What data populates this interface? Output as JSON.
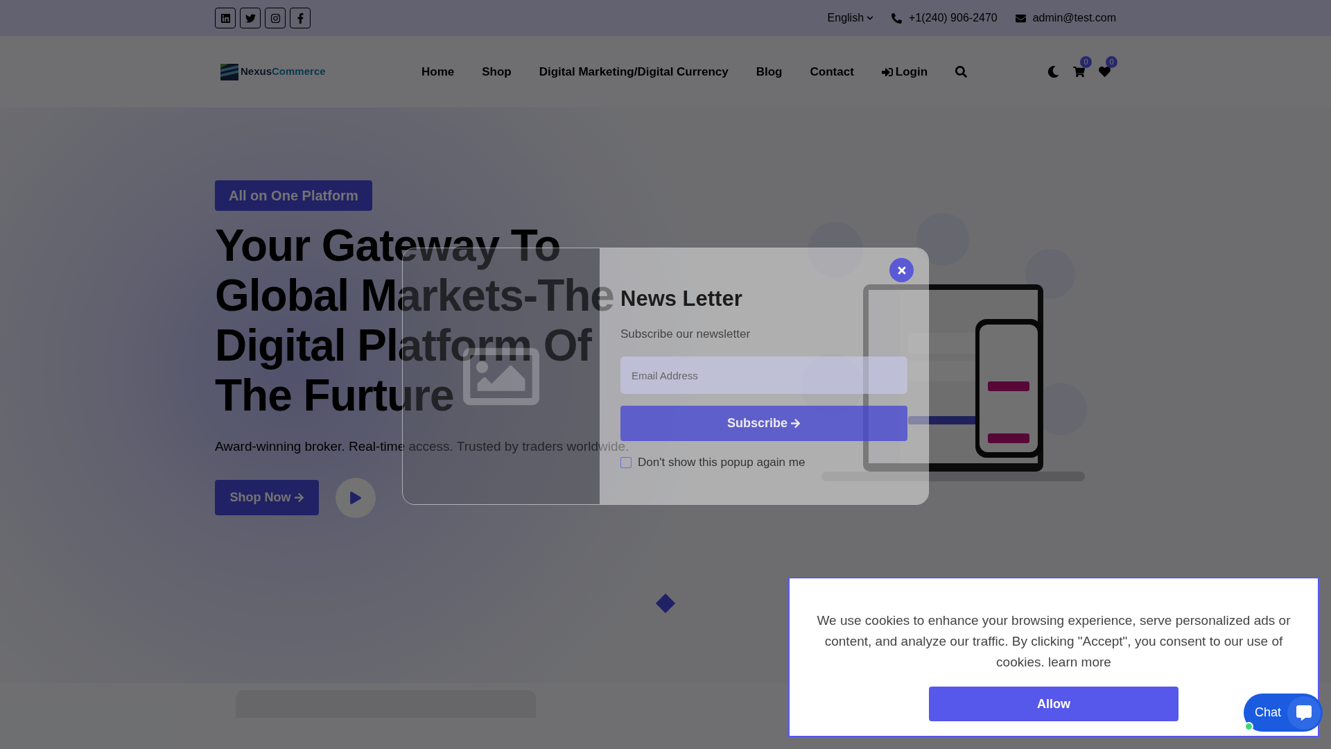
{
  "top_bar": {
    "language": "English",
    "phone": "+1(240) 906-2470",
    "email": "admin@test.com"
  },
  "logo": {
    "part_1": "Nexus",
    "part_2": "Commerce"
  },
  "nav": {
    "items": [
      {
        "label": "Home"
      },
      {
        "label": "Shop"
      },
      {
        "label": "Digital Marketing/Digital Currency"
      },
      {
        "label": "Blog"
      },
      {
        "label": "Contact"
      }
    ],
    "login": "Login",
    "cart_count": "0",
    "wishlist_count": "0"
  },
  "hero": {
    "badge": "All on One Platform",
    "title_lines": [
      "Your Gateway To",
      "Global Markets-The",
      "Digital Platform Of",
      "The Furture"
    ],
    "subtitle": "Award-winning broker. Real-time access. Trusted by traders worldwide.",
    "cta": "Shop Now"
  },
  "popup": {
    "title": "News Letter",
    "subtitle": "Subscribe our newsletter",
    "email_placeholder": "Email Address",
    "button": "Subscribe",
    "checkbox": {
      "label": "Don't show this popup again me",
      "checked": false
    }
  },
  "cookie_banner": {
    "text": "We use cookies to enhance your browsing experience, serve personalized ads or content, and analyze our traffic. By clicking \"Accept\", you consent to our use of cookies.",
    "link": "learn more",
    "button": "Allow"
  },
  "chat": {
    "label": "Chat",
    "online": true
  }
}
